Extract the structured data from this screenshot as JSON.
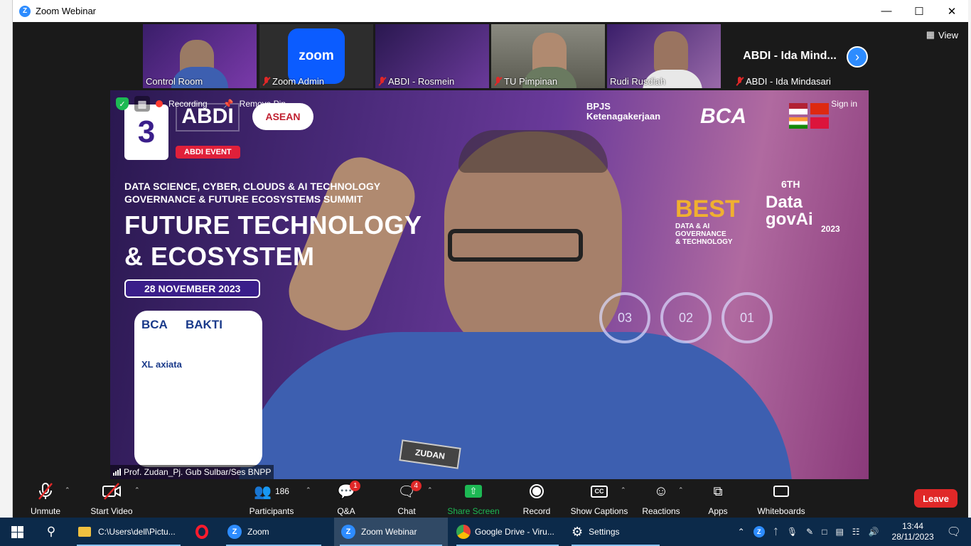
{
  "window": {
    "title": "Zoom Webinar",
    "icon": "zoom-icon"
  },
  "view_button": {
    "label": "View",
    "icon": "grid-view-icon"
  },
  "thumbnails": [
    {
      "name": "Control Room",
      "muted": false
    },
    {
      "name": "Zoom Admin",
      "muted": true,
      "logo_text": "zoom"
    },
    {
      "name": "ABDI - Rosmein",
      "muted": true
    },
    {
      "name": "TU Pimpinan",
      "muted": true
    },
    {
      "name": "Rudi Rusdiah",
      "muted": false
    },
    {
      "name": "ABDI - Ida Mindasari",
      "muted": true,
      "big_label": "ABDI - Ida Mind..."
    }
  ],
  "main_video": {
    "recording_label": "Recording",
    "remove_pin_label": "Remove Pin",
    "sign_in_label": "Sign in",
    "speaker_name": "Prof. Zudan_Pj. Gub Sulbar/Ses BNPP",
    "backdrop": {
      "day_label": "3",
      "abdi_label": "ABDI",
      "asean_label": "ASEAN",
      "event_badge": "ABDI EVENT",
      "summit_line1": "DATA SCIENCE, CYBER, CLOUDS & AI TECHNOLOGY",
      "summit_line2": "GOVERNANCE & FUTURE ECOSYSTEMS SUMMIT",
      "headline1": "FUTURE TECHNOLOGY",
      "headline2": "& ECOSYSTEM",
      "date": "28 NOVEMBER 2023",
      "sponsor_bca": "BCA",
      "sponsor_bakti": "BAKTI",
      "sponsor_xl": "XL axiata",
      "bpjs_line1": "BPJS",
      "bpjs_line2": "Ketenagakerjaan",
      "bca_logo": "BCA",
      "best_label": "BEST",
      "best_sub1": "DATA & AI",
      "best_sub2": "GOVERNANCE",
      "best_sub3": "& TECHNOLOGY",
      "six_label": "6TH",
      "datagov_line1": "Data",
      "datagov_line2": "govAi",
      "datagov_year": "2023",
      "dial1": "03",
      "dial2": "02",
      "dial3": "01",
      "nametag": "ZUDAN"
    }
  },
  "toolbar": {
    "unmute": "Unmute",
    "start_video": "Start Video",
    "participants": "Participants",
    "participants_count": "186",
    "qa": "Q&A",
    "qa_badge": "1",
    "chat": "Chat",
    "chat_badge": "4",
    "share_screen": "Share Screen",
    "record": "Record",
    "show_captions": "Show Captions",
    "reactions": "Reactions",
    "apps": "Apps",
    "whiteboards": "Whiteboards",
    "leave": "Leave",
    "colors": {
      "share": "#1db954",
      "leave": "#e02828",
      "muted": "#e02828"
    }
  },
  "taskbar": {
    "items": [
      {
        "label": "C:\\Users\\dell\\Pictu...",
        "icon": "folder-icon"
      },
      {
        "label": "",
        "icon": "opera-icon"
      },
      {
        "label": "Zoom",
        "icon": "zoom-icon"
      },
      {
        "label": "Zoom Webinar",
        "icon": "zoom-icon",
        "active": true
      },
      {
        "label": "Google Drive - Viru...",
        "icon": "chrome-icon"
      },
      {
        "label": "Settings",
        "icon": "gear-icon"
      }
    ],
    "time": "13:44",
    "date": "28/11/2023"
  }
}
